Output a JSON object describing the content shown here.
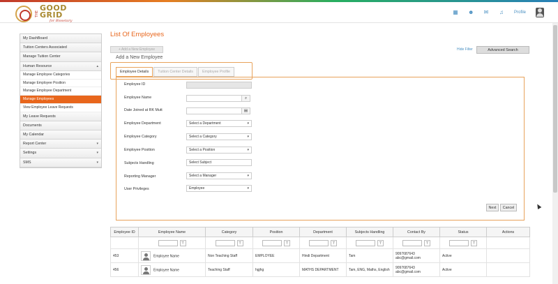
{
  "brand": {
    "the": "THE",
    "name_line1": "GOOD",
    "name_line2": "GRID",
    "tagline": "for Bissetary"
  },
  "topbar": {
    "icons": [
      "grid-icon",
      "users-icon",
      "mail-icon",
      "bell-icon"
    ],
    "profile_label": "Profile"
  },
  "sidebar": {
    "items": [
      {
        "label": "My DashBoard"
      },
      {
        "label": "Tuition Centers Associated"
      },
      {
        "label": "Manage Tuition Center"
      },
      {
        "label": "Human Resource",
        "caret": "▴"
      }
    ],
    "hr_subitems": [
      {
        "label": "Manage Employee Categories"
      },
      {
        "label": "Manage Employee Position"
      },
      {
        "label": "Manage Employee Department"
      },
      {
        "label": "Manage Employees",
        "active": true
      },
      {
        "label": "View Employee Leave Requests"
      }
    ],
    "items_after": [
      {
        "label": "My Leave Requests"
      },
      {
        "label": "Documents"
      },
      {
        "label": "My Calendar"
      },
      {
        "label": "Report Center",
        "caret": "▾"
      },
      {
        "label": "Settings",
        "caret": "▾"
      },
      {
        "label": "SMS",
        "caret": "▾"
      }
    ]
  },
  "main": {
    "title": "List Of Employees",
    "add_button": "+ Add a New Employee",
    "add_header": "Add a New Employee",
    "hide_filter": "Hide Filter",
    "advanced_search": "Advanced Search",
    "tabs": [
      {
        "label": "Employee Details",
        "active": true
      },
      {
        "label": "Tuition Center Details"
      },
      {
        "label": "Employee Profile"
      }
    ],
    "form": {
      "employee_id_label": "Employee ID",
      "employee_name_label": "Employee Name",
      "date_joined_label": "Date Joined at RK Mutt",
      "department_label": "Employee Department",
      "department_value": "Select a Department",
      "category_label": "Employee Category",
      "category_value": "Select a Category",
      "position_label": "Employee Position",
      "position_value": "Select a Position",
      "subjects_label": "Subjects Handling",
      "subjects_value": "Select Subject",
      "manager_label": "Reporting Manager",
      "manager_value": "Select a Manager",
      "privileges_label": "User Privileges",
      "privileges_value": "Employee",
      "next_button": "Next",
      "cancel_button": "Cancel"
    },
    "table": {
      "headers": [
        "Employee ID",
        "Employee Name",
        "Category",
        "Position",
        "Department",
        "Subjects Handling",
        "Contact By",
        "Status",
        "Actions"
      ],
      "rows": [
        {
          "id": "453",
          "name": "Employee Name",
          "category": "Non Teaching Staff",
          "position": "EMPLOYEE",
          "department": "Hindi Department",
          "subjects": "Tam",
          "phone": "9097687643",
          "email": "abc@gmail.com",
          "status": "Active"
        },
        {
          "id": "456",
          "name": "Employee Name",
          "category": "Teaching Staff",
          "position": "hgjhg",
          "department": "MATHS DEPARTMENT",
          "subjects": "Tam, ENG, Maths, English",
          "phone": "9097687643",
          "email": "abc@gmail.com",
          "status": "Active"
        }
      ]
    }
  }
}
